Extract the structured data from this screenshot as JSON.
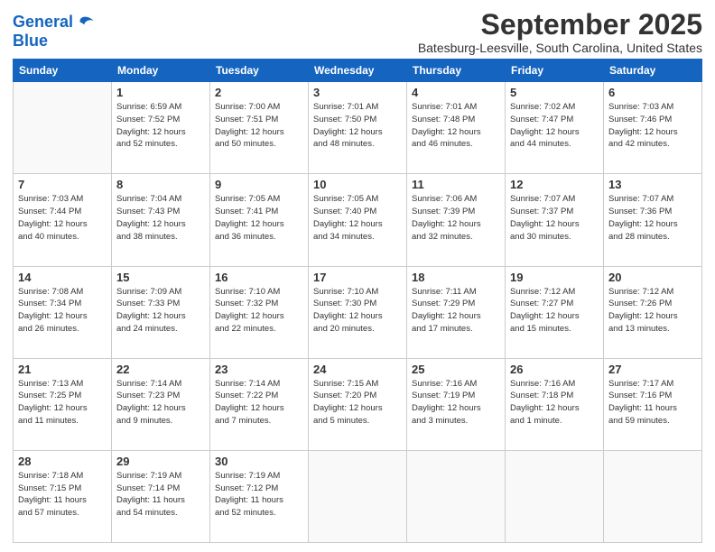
{
  "logo": {
    "line1": "General",
    "line2": "Blue"
  },
  "title": "September 2025",
  "location": "Batesburg-Leesville, South Carolina, United States",
  "headers": [
    "Sunday",
    "Monday",
    "Tuesday",
    "Wednesday",
    "Thursday",
    "Friday",
    "Saturday"
  ],
  "weeks": [
    [
      {
        "day": "",
        "info": ""
      },
      {
        "day": "1",
        "info": "Sunrise: 6:59 AM\nSunset: 7:52 PM\nDaylight: 12 hours\nand 52 minutes."
      },
      {
        "day": "2",
        "info": "Sunrise: 7:00 AM\nSunset: 7:51 PM\nDaylight: 12 hours\nand 50 minutes."
      },
      {
        "day": "3",
        "info": "Sunrise: 7:01 AM\nSunset: 7:50 PM\nDaylight: 12 hours\nand 48 minutes."
      },
      {
        "day": "4",
        "info": "Sunrise: 7:01 AM\nSunset: 7:48 PM\nDaylight: 12 hours\nand 46 minutes."
      },
      {
        "day": "5",
        "info": "Sunrise: 7:02 AM\nSunset: 7:47 PM\nDaylight: 12 hours\nand 44 minutes."
      },
      {
        "day": "6",
        "info": "Sunrise: 7:03 AM\nSunset: 7:46 PM\nDaylight: 12 hours\nand 42 minutes."
      }
    ],
    [
      {
        "day": "7",
        "info": "Sunrise: 7:03 AM\nSunset: 7:44 PM\nDaylight: 12 hours\nand 40 minutes."
      },
      {
        "day": "8",
        "info": "Sunrise: 7:04 AM\nSunset: 7:43 PM\nDaylight: 12 hours\nand 38 minutes."
      },
      {
        "day": "9",
        "info": "Sunrise: 7:05 AM\nSunset: 7:41 PM\nDaylight: 12 hours\nand 36 minutes."
      },
      {
        "day": "10",
        "info": "Sunrise: 7:05 AM\nSunset: 7:40 PM\nDaylight: 12 hours\nand 34 minutes."
      },
      {
        "day": "11",
        "info": "Sunrise: 7:06 AM\nSunset: 7:39 PM\nDaylight: 12 hours\nand 32 minutes."
      },
      {
        "day": "12",
        "info": "Sunrise: 7:07 AM\nSunset: 7:37 PM\nDaylight: 12 hours\nand 30 minutes."
      },
      {
        "day": "13",
        "info": "Sunrise: 7:07 AM\nSunset: 7:36 PM\nDaylight: 12 hours\nand 28 minutes."
      }
    ],
    [
      {
        "day": "14",
        "info": "Sunrise: 7:08 AM\nSunset: 7:34 PM\nDaylight: 12 hours\nand 26 minutes."
      },
      {
        "day": "15",
        "info": "Sunrise: 7:09 AM\nSunset: 7:33 PM\nDaylight: 12 hours\nand 24 minutes."
      },
      {
        "day": "16",
        "info": "Sunrise: 7:10 AM\nSunset: 7:32 PM\nDaylight: 12 hours\nand 22 minutes."
      },
      {
        "day": "17",
        "info": "Sunrise: 7:10 AM\nSunset: 7:30 PM\nDaylight: 12 hours\nand 20 minutes."
      },
      {
        "day": "18",
        "info": "Sunrise: 7:11 AM\nSunset: 7:29 PM\nDaylight: 12 hours\nand 17 minutes."
      },
      {
        "day": "19",
        "info": "Sunrise: 7:12 AM\nSunset: 7:27 PM\nDaylight: 12 hours\nand 15 minutes."
      },
      {
        "day": "20",
        "info": "Sunrise: 7:12 AM\nSunset: 7:26 PM\nDaylight: 12 hours\nand 13 minutes."
      }
    ],
    [
      {
        "day": "21",
        "info": "Sunrise: 7:13 AM\nSunset: 7:25 PM\nDaylight: 12 hours\nand 11 minutes."
      },
      {
        "day": "22",
        "info": "Sunrise: 7:14 AM\nSunset: 7:23 PM\nDaylight: 12 hours\nand 9 minutes."
      },
      {
        "day": "23",
        "info": "Sunrise: 7:14 AM\nSunset: 7:22 PM\nDaylight: 12 hours\nand 7 minutes."
      },
      {
        "day": "24",
        "info": "Sunrise: 7:15 AM\nSunset: 7:20 PM\nDaylight: 12 hours\nand 5 minutes."
      },
      {
        "day": "25",
        "info": "Sunrise: 7:16 AM\nSunset: 7:19 PM\nDaylight: 12 hours\nand 3 minutes."
      },
      {
        "day": "26",
        "info": "Sunrise: 7:16 AM\nSunset: 7:18 PM\nDaylight: 12 hours\nand 1 minute."
      },
      {
        "day": "27",
        "info": "Sunrise: 7:17 AM\nSunset: 7:16 PM\nDaylight: 11 hours\nand 59 minutes."
      }
    ],
    [
      {
        "day": "28",
        "info": "Sunrise: 7:18 AM\nSunset: 7:15 PM\nDaylight: 11 hours\nand 57 minutes."
      },
      {
        "day": "29",
        "info": "Sunrise: 7:19 AM\nSunset: 7:14 PM\nDaylight: 11 hours\nand 54 minutes."
      },
      {
        "day": "30",
        "info": "Sunrise: 7:19 AM\nSunset: 7:12 PM\nDaylight: 11 hours\nand 52 minutes."
      },
      {
        "day": "",
        "info": ""
      },
      {
        "day": "",
        "info": ""
      },
      {
        "day": "",
        "info": ""
      },
      {
        "day": "",
        "info": ""
      }
    ]
  ]
}
